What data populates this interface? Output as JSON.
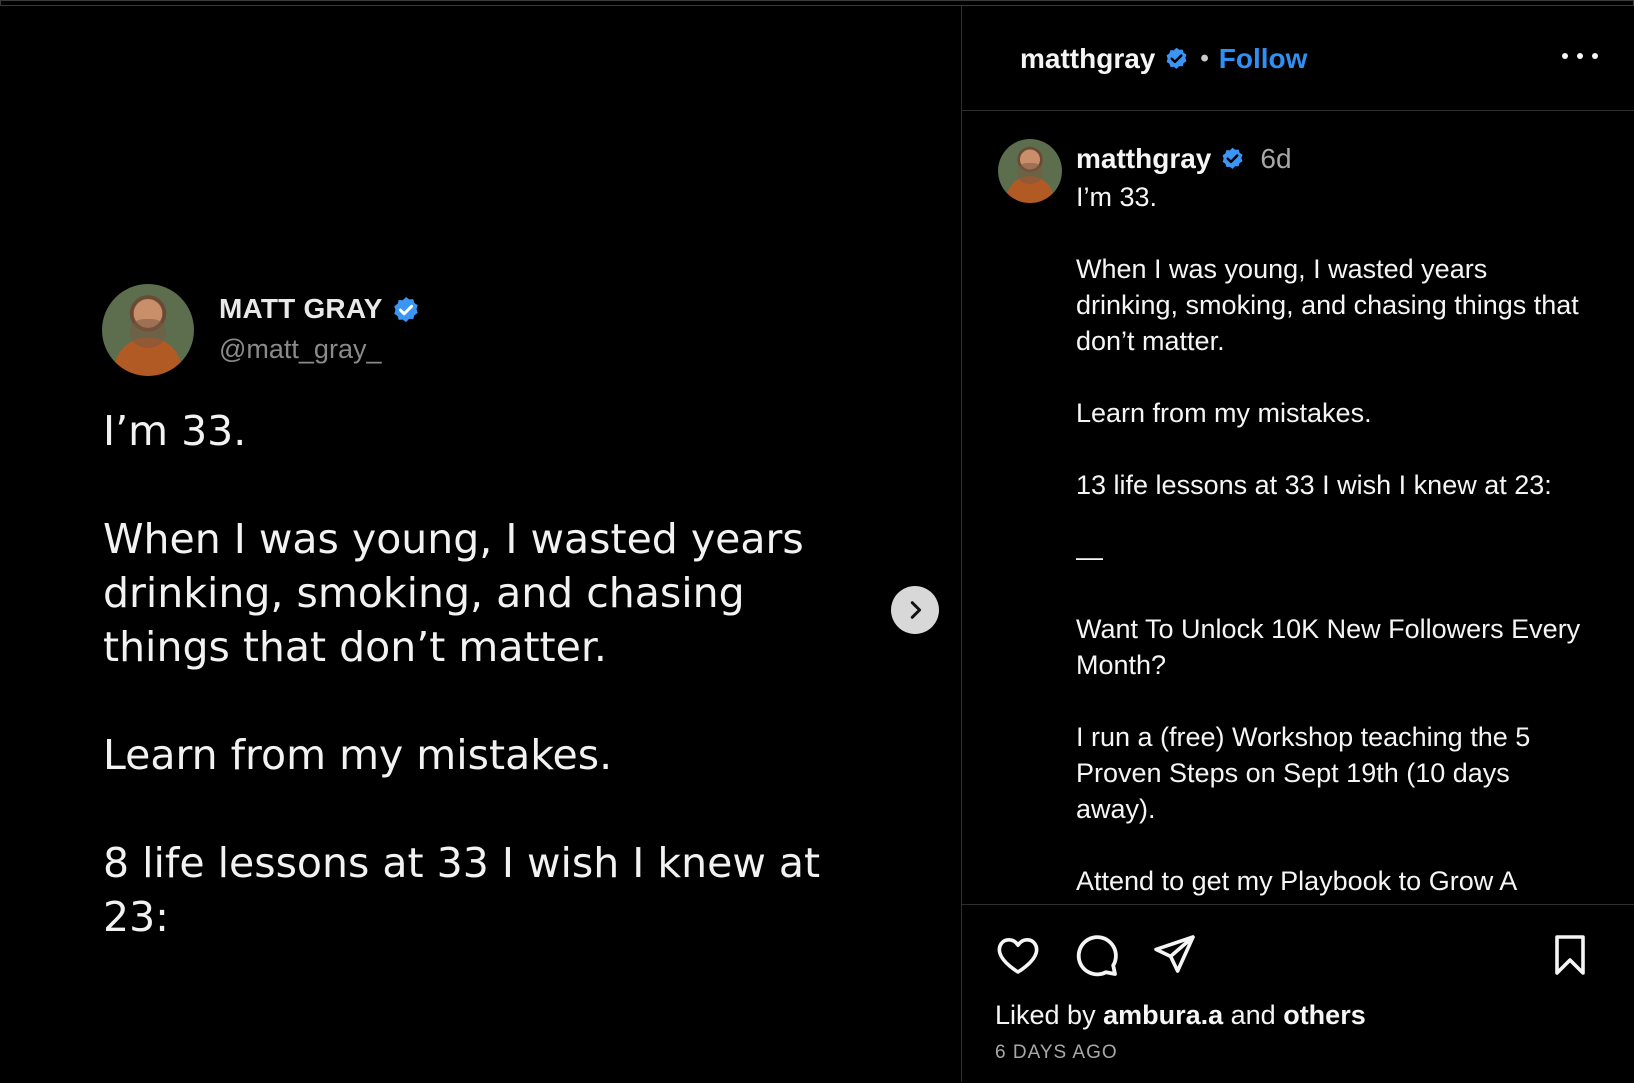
{
  "colors": {
    "accent": "#2f8ff3",
    "verified": "#3b95f4",
    "background": "#000000"
  },
  "tweet": {
    "name": "MATT GRAY",
    "handle": "@matt_gray_",
    "body": "I’m 33.\n\nWhen I was young, I wasted years drinking, smoking, and chasing things that don’t matter.\n\nLearn from my mistakes.\n\n8 life lessons at 33 I wish I knew at 23:"
  },
  "carousel": {
    "next_icon": "chevron-right-icon"
  },
  "header": {
    "username": "matthgray",
    "separator": "•",
    "follow_label": "Follow",
    "more_icon": "more-horizontal-icon"
  },
  "caption": {
    "username": "matthgray",
    "time": "6d",
    "text": "I’m 33.\n\nWhen I was young, I wasted years drinking, smoking, and chasing things that don’t matter.\n\nLearn from my mistakes.\n\n13 life lessons at 33 I wish I knew at 23:\n\n—\n\nWant To Unlock 10K New Followers Every Month?\n\nI run a (free) Workshop teaching the 5 Proven Steps on Sept 19th (10 days away).\n\nAttend to get my Playbook to Grow A"
  },
  "actions": {
    "like_icon": "heart-icon",
    "comment_icon": "comment-icon",
    "share_icon": "send-icon",
    "save_icon": "bookmark-icon"
  },
  "likes": {
    "prefix": "Liked by ",
    "user": "ambura.a",
    "middle": " and ",
    "others": "others"
  },
  "timestamp": "6 DAYS AGO"
}
